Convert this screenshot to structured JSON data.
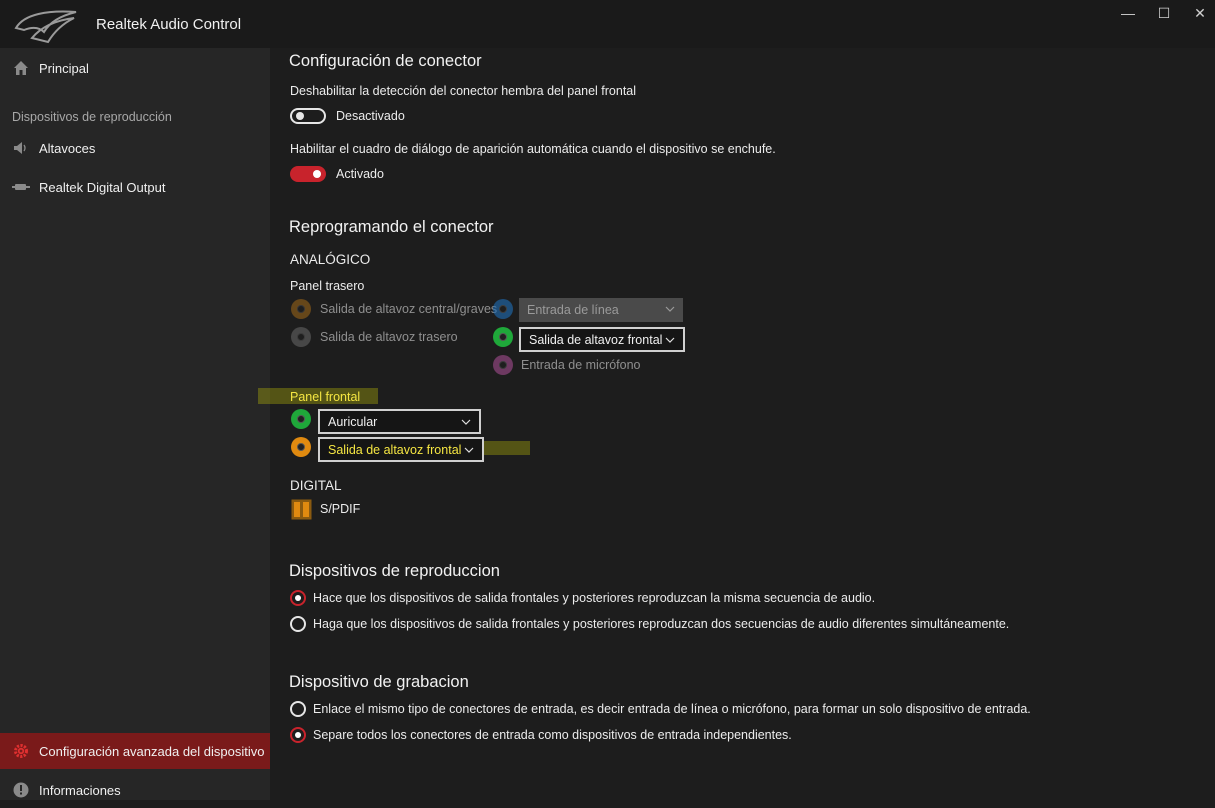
{
  "window": {
    "title": "Realtek Audio Control",
    "controls": {
      "minimize": "—",
      "maximize": "☐",
      "close": "✕"
    }
  },
  "sidebar": {
    "home": "Principal",
    "section_label": "Dispositivos de reproducción",
    "items": [
      {
        "label": "Altavoces",
        "icon": "speaker-icon"
      },
      {
        "label": "Realtek Digital Output",
        "icon": "digital-output-icon"
      }
    ],
    "advanced": "Configuración avanzada del dispositivo",
    "info": "Informaciones"
  },
  "connector_config": {
    "title": "Configuración de conector",
    "front_panel_detection_label": "Deshabilitar la detección del conector hembra del panel frontal",
    "front_panel_detection_state": "Desactivado",
    "front_panel_detection_on": false,
    "auto_popup_label": "Habilitar el cuadro de diálogo de aparición automática cuando el dispositivo se enchufe.",
    "auto_popup_state": "Activado",
    "auto_popup_on": true
  },
  "retasking": {
    "title": "Reprogramando el conector",
    "analog_label": "ANALÓGICO",
    "rear_panel_label": "Panel trasero",
    "rear_left": [
      {
        "label": "Salida de altavoz central/graves",
        "color": "#c07a18"
      },
      {
        "label": "Salida de altavoz trasero",
        "color": "#6a6a6a"
      }
    ],
    "rear_right": [
      {
        "value": "Entrada de línea",
        "color": "#1f6fb8",
        "disabled": true
      },
      {
        "value": "Salida de altavoz frontal",
        "color": "#1fa83a",
        "disabled": false
      },
      {
        "label": "Entrada de micrófono",
        "color": "#b0509a"
      }
    ],
    "front_panel_label": "Panel frontal",
    "front": [
      {
        "value": "Auricular",
        "color": "#1fa83a"
      },
      {
        "value": "Salida de altavoz frontal",
        "color": "#e08a10"
      }
    ],
    "digital_label": "DIGITAL",
    "spdif_label": "S/PDIF"
  },
  "playback": {
    "title": "Dispositivos de reproduccion",
    "options": [
      {
        "label": "Hace que los dispositivos de salida frontales y posteriores reproduzcan la misma secuencia de audio.",
        "selected": true
      },
      {
        "label": "Haga que los dispositivos de salida frontales y posteriores reproduzcan dos secuencias de audio diferentes simultáneamente.",
        "selected": false
      }
    ]
  },
  "recording": {
    "title": "Dispositivo de grabacion",
    "options": [
      {
        "label": "Enlace el mismo tipo de conectores de entrada, es decir entrada de línea o micrófono, para formar un solo dispositivo de entrada.",
        "selected": false
      },
      {
        "label": "Separe todos los conectores de entrada como dispositivos de entrada independientes.",
        "selected": true
      }
    ]
  },
  "colors": {
    "accent": "#c8232c",
    "sidebar_active": "#7a1a1a",
    "highlight": "#f5e642"
  }
}
